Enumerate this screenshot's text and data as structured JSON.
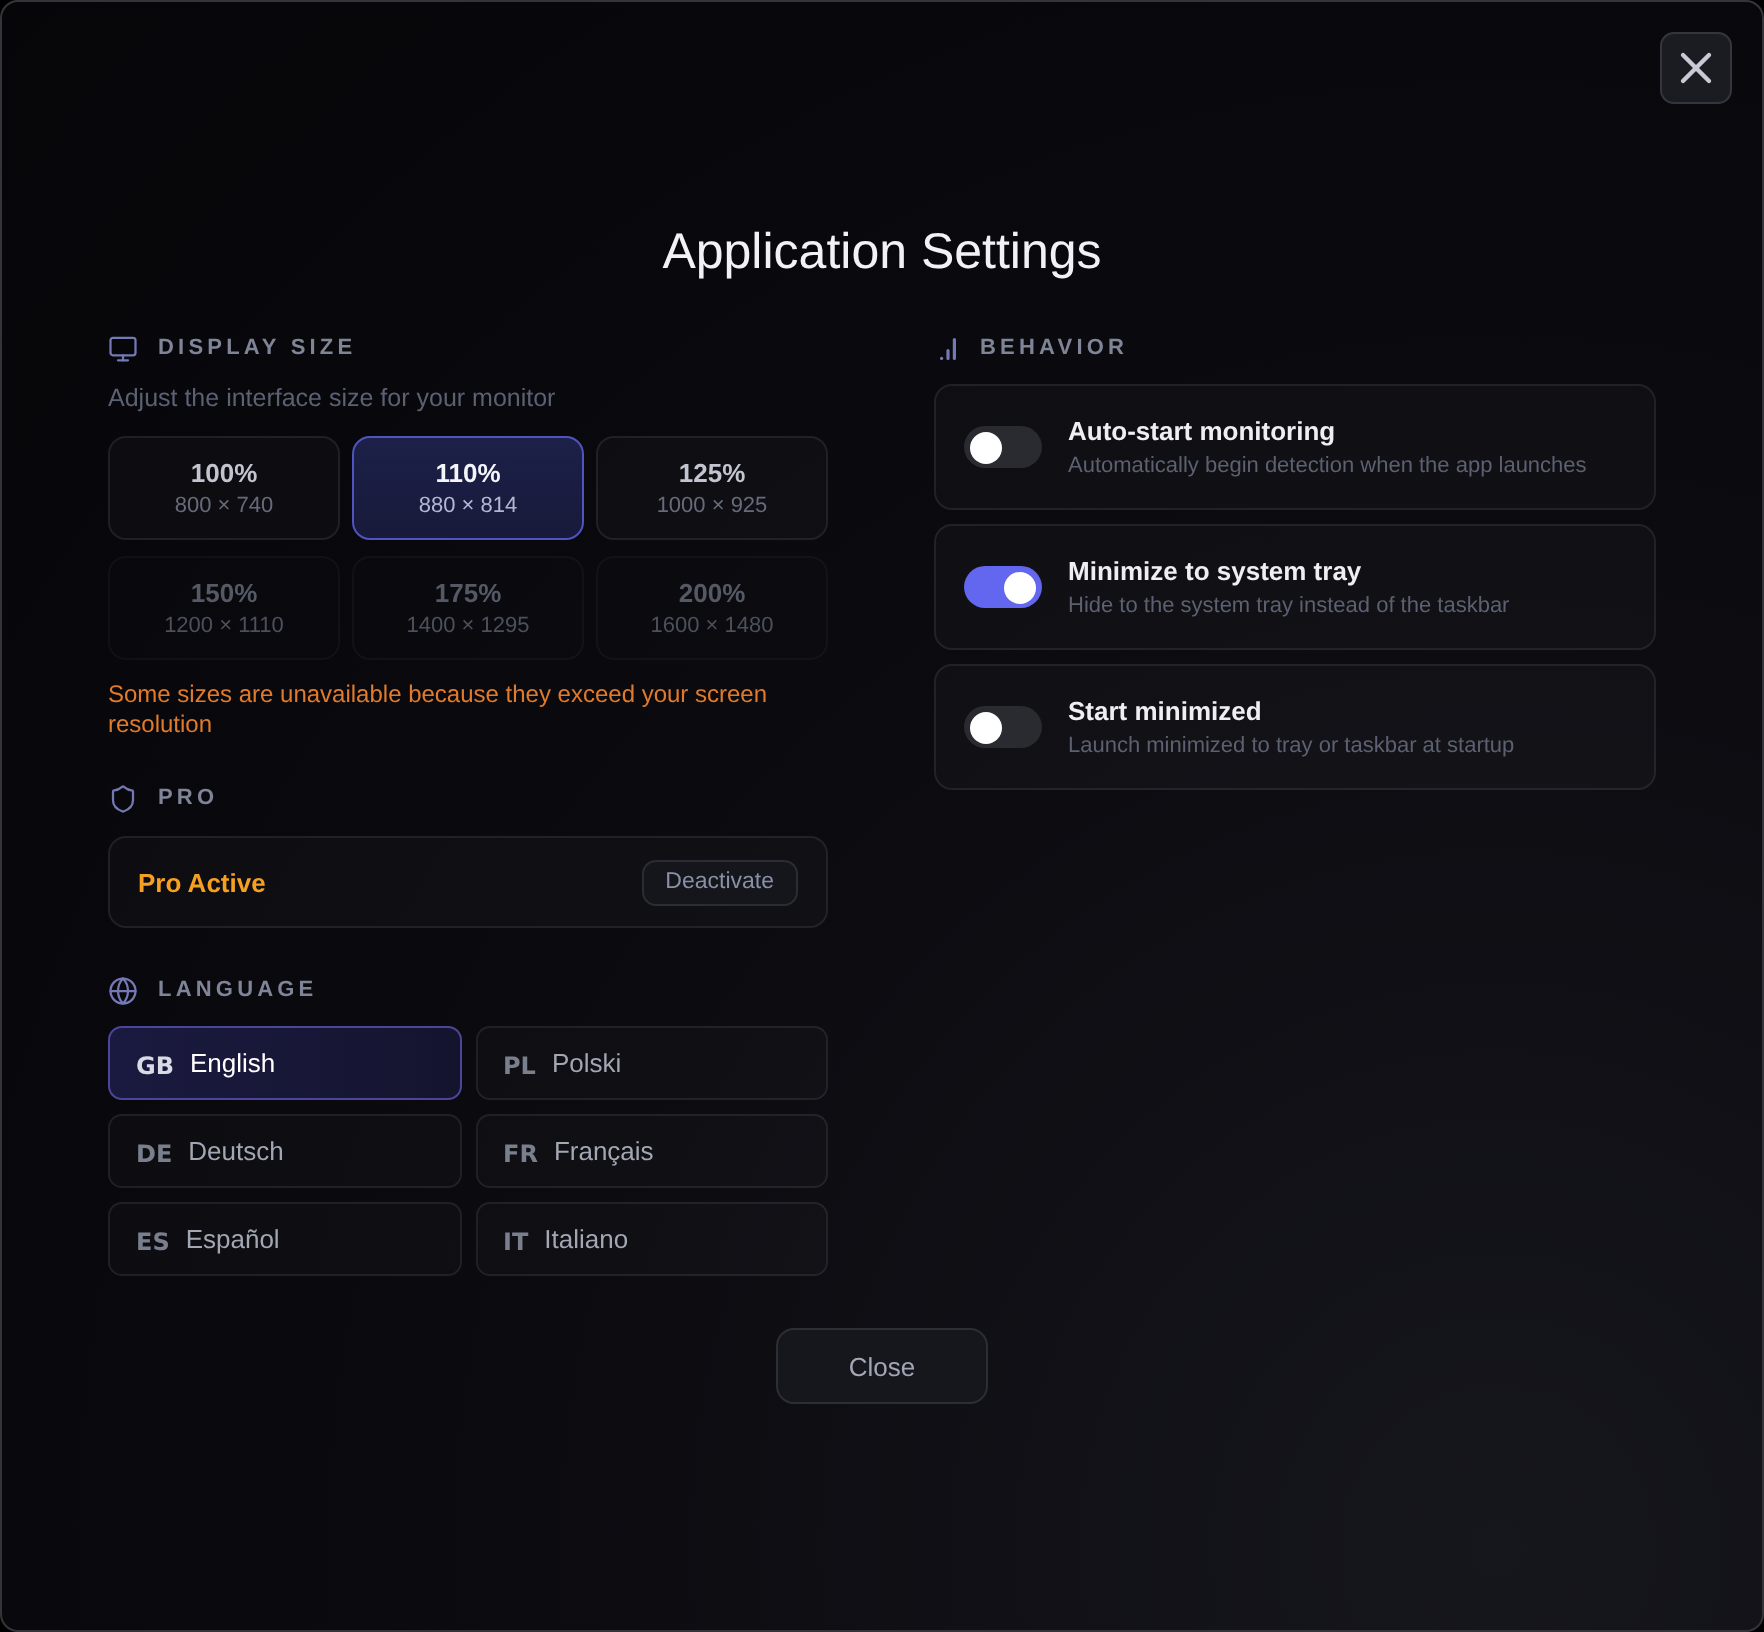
{
  "window": {
    "title": "Application Settings"
  },
  "display_size": {
    "heading": "DISPLAY SIZE",
    "description": "Adjust the interface size for your monitor",
    "options": [
      {
        "label": "100%",
        "resolution": "800 × 740",
        "selected": false,
        "disabled": false
      },
      {
        "label": "110%",
        "resolution": "880 × 814",
        "selected": true,
        "disabled": false
      },
      {
        "label": "125%",
        "resolution": "1000 × 925",
        "selected": false,
        "disabled": false
      },
      {
        "label": "150%",
        "resolution": "1200 × 1110",
        "selected": false,
        "disabled": true
      },
      {
        "label": "175%",
        "resolution": "1400 × 1295",
        "selected": false,
        "disabled": true
      },
      {
        "label": "200%",
        "resolution": "1600 × 1480",
        "selected": false,
        "disabled": true
      }
    ],
    "warning": "Some sizes are unavailable because they exceed your screen resolution"
  },
  "pro": {
    "heading": "PRO",
    "status": "Pro Active",
    "button": "Deactivate"
  },
  "language": {
    "heading": "LANGUAGE",
    "options": [
      {
        "code": "GB",
        "name": "English",
        "selected": true
      },
      {
        "code": "PL",
        "name": "Polski",
        "selected": false
      },
      {
        "code": "DE",
        "name": "Deutsch",
        "selected": false
      },
      {
        "code": "FR",
        "name": "Français",
        "selected": false
      },
      {
        "code": "ES",
        "name": "Español",
        "selected": false
      },
      {
        "code": "IT",
        "name": "Italiano",
        "selected": false
      }
    ]
  },
  "behavior": {
    "heading": "BEHAVIOR",
    "settings": [
      {
        "title": "Auto-start monitoring",
        "description": "Automatically begin detection when the app launches",
        "on": false
      },
      {
        "title": "Minimize to system tray",
        "description": "Hide to the system tray instead of the taskbar",
        "on": true
      },
      {
        "title": "Start minimized",
        "description": "Launch minimized to tray or taskbar at startup",
        "on": false
      }
    ]
  },
  "footer": {
    "button": "Close"
  }
}
